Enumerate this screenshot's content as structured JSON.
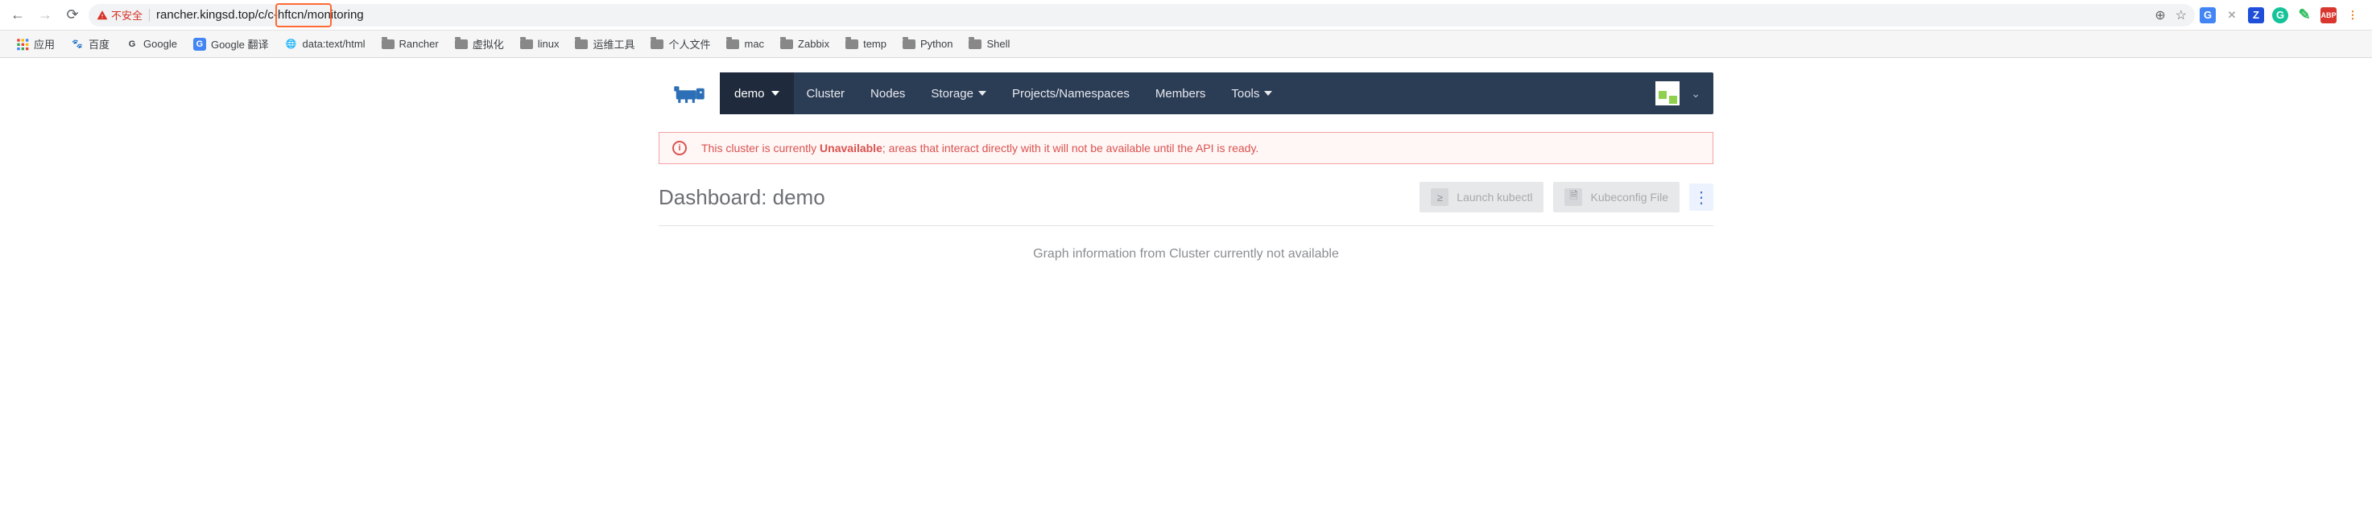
{
  "browser": {
    "not_secure_label": "不安全",
    "url": "rancher.kingsd.top/c/c-hftcn/monitoring",
    "bookmarks_label": "应用",
    "bookmarks": [
      {
        "label": "百度",
        "type": "site",
        "icon": "baidu"
      },
      {
        "label": "Google",
        "type": "site",
        "icon": "google"
      },
      {
        "label": "Google 翻译",
        "type": "site",
        "icon": "gtranslate"
      },
      {
        "label": "data:text/html",
        "type": "site",
        "icon": "globe"
      },
      {
        "label": "Rancher",
        "type": "folder"
      },
      {
        "label": "虚拟化",
        "type": "folder"
      },
      {
        "label": "linux",
        "type": "folder"
      },
      {
        "label": "运维工具",
        "type": "folder"
      },
      {
        "label": "个人文件",
        "type": "folder"
      },
      {
        "label": "mac",
        "type": "folder"
      },
      {
        "label": "Zabbix",
        "type": "folder"
      },
      {
        "label": "temp",
        "type": "folder"
      },
      {
        "label": "Python",
        "type": "folder"
      },
      {
        "label": "Shell",
        "type": "folder"
      }
    ]
  },
  "nav": {
    "cluster_name": "demo",
    "items": [
      {
        "label": "Cluster",
        "dropdown": false
      },
      {
        "label": "Nodes",
        "dropdown": false
      },
      {
        "label": "Storage",
        "dropdown": true
      },
      {
        "label": "Projects/Namespaces",
        "dropdown": false
      },
      {
        "label": "Members",
        "dropdown": false
      },
      {
        "label": "Tools",
        "dropdown": true
      }
    ]
  },
  "alert": {
    "prefix": "This cluster is currently ",
    "strong": "Unavailable",
    "suffix": "; areas that interact directly with it will not be available until the API is ready."
  },
  "dashboard": {
    "title": "Dashboard: demo",
    "launch_btn": "Launch kubectl",
    "kubeconfig_btn": "Kubeconfig File"
  },
  "graph_msg": "Graph information from Cluster currently not available"
}
